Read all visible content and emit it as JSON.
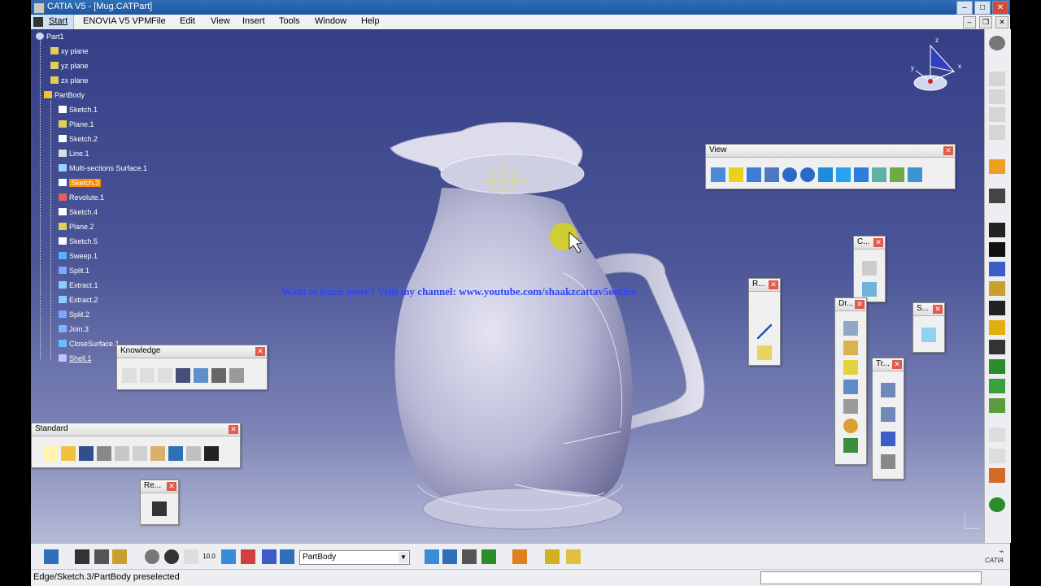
{
  "window": {
    "title": "CATIA V5 - [Mug.CATPart]",
    "controls": [
      "–",
      "□",
      "✕"
    ]
  },
  "menu": {
    "start": "Start",
    "items": [
      "ENOVIA V5 VPM",
      "File",
      "Edit",
      "View",
      "Insert",
      "Tools",
      "Window",
      "Help"
    ]
  },
  "tree": {
    "root": "Part1",
    "nodes": [
      {
        "label": "xy plane",
        "icon": "plane-icon"
      },
      {
        "label": "yz plane",
        "icon": "plane-icon"
      },
      {
        "label": "zx plane",
        "icon": "plane-icon"
      },
      {
        "label": "PartBody",
        "icon": "partbody-icon"
      },
      {
        "label": "Sketch.1",
        "icon": "sketch-icon"
      },
      {
        "label": "Plane.1",
        "icon": "plane-icon"
      },
      {
        "label": "Sketch.2",
        "icon": "sketch-icon"
      },
      {
        "label": "Line.1",
        "icon": "line-icon"
      },
      {
        "label": "Multi-sections Surface.1",
        "icon": "multisection-surface-icon"
      },
      {
        "label": "Sketch.3",
        "icon": "sketch-icon",
        "selected": true
      },
      {
        "label": "Revolute.1",
        "icon": "revolute-icon"
      },
      {
        "label": "Sketch.4",
        "icon": "sketch-icon"
      },
      {
        "label": "Plane.2",
        "icon": "plane-icon"
      },
      {
        "label": "Sketch.5",
        "icon": "sketch-icon"
      },
      {
        "label": "Sweep.1",
        "icon": "sweep-icon"
      },
      {
        "label": "Split.1",
        "icon": "split-icon"
      },
      {
        "label": "Extract.1",
        "icon": "extract-icon"
      },
      {
        "label": "Extract.2",
        "icon": "extract-icon"
      },
      {
        "label": "Split.2",
        "icon": "split-icon"
      },
      {
        "label": "Join.3",
        "icon": "join-icon"
      },
      {
        "label": "CloseSurface.1",
        "icon": "closesurface-icon"
      },
      {
        "label": "Shell.1",
        "icon": "shell-icon",
        "underline": true
      }
    ]
  },
  "toolbars": {
    "view": {
      "title": "View"
    },
    "knowledge": {
      "title": "Knowledge"
    },
    "standard": {
      "title": "Standard"
    },
    "re": {
      "title": "Re..."
    },
    "c": {
      "title": "C..."
    },
    "r": {
      "title": "R..."
    },
    "dr": {
      "title": "Dr..."
    },
    "s": {
      "title": "S..."
    },
    "tr": {
      "title": "Tr..."
    }
  },
  "overlay": {
    "watermark": "Want to learn more? Visit my channel: www.youtube.com/shaakzcattav5online"
  },
  "bottom_toolbar": {
    "body_select": "PartBody",
    "scale_label": "10.0"
  },
  "status": {
    "message": "Edge/Sketch.3/PartBody preselected"
  },
  "compass": {
    "x": "x",
    "y": "y",
    "z": "z"
  },
  "brand": {
    "catia": "CATIA"
  },
  "colors": {
    "background_top": "#353f86",
    "background_bottom": "#b6bad6",
    "selection": "#ff8a00",
    "model": "#c8c8e0",
    "watermark": "#2b44ff"
  }
}
